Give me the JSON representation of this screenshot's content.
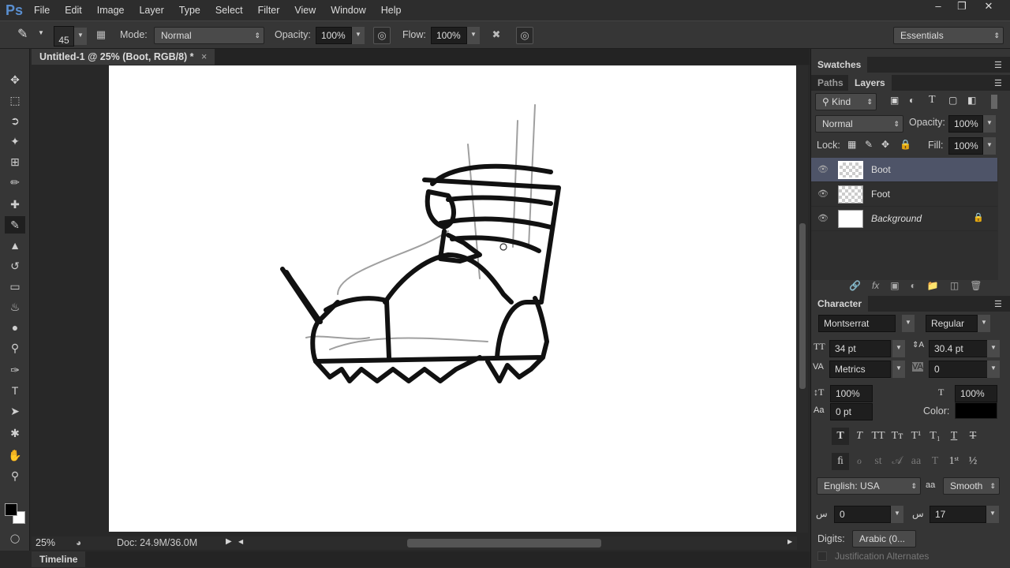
{
  "app": {
    "logo": "Ps",
    "menu": [
      "File",
      "Edit",
      "Image",
      "Layer",
      "Type",
      "Select",
      "Filter",
      "View",
      "Window",
      "Help"
    ],
    "window_controls": [
      "minimize",
      "restore",
      "close"
    ]
  },
  "options": {
    "brush_size": "45",
    "mode_label": "Mode:",
    "mode_value": "Normal",
    "opacity_label": "Opacity:",
    "opacity_value": "100%",
    "flow_label": "Flow:",
    "flow_value": "100%",
    "workspace": "Essentials"
  },
  "document": {
    "tab_title": "Untitled-1 @ 25% (Boot, RGB/8) *",
    "close": "×"
  },
  "status": {
    "zoom": "25%",
    "doc_info": "Doc: 24.9M/36.0M"
  },
  "timeline": {
    "label": "Timeline"
  },
  "swatches": {
    "tab": "Swatches"
  },
  "layers_panel": {
    "tabs": [
      "Paths",
      "Layers"
    ],
    "filter": "Kind",
    "blend_mode": "Normal",
    "opacity_label": "Opacity:",
    "opacity_value": "100%",
    "lock_label": "Lock:",
    "fill_label": "Fill:",
    "fill_value": "100%",
    "layers": [
      {
        "name": "Boot",
        "selected": true
      },
      {
        "name": "Foot"
      },
      {
        "name": "Background",
        "locked": true
      }
    ]
  },
  "character": {
    "tab": "Character",
    "font_family": "Montserrat",
    "font_style": "Regular",
    "size": "34 pt",
    "leading": "30.4 pt",
    "kerning": "Metrics",
    "tracking": "0",
    "vscale": "100%",
    "hscale": "100%",
    "baseline": "0 pt",
    "color_label": "Color:",
    "color": "#000000",
    "language": "English: USA",
    "antialias": "Smooth",
    "kashida_1": "0",
    "kashida_2": "17",
    "digits_label": "Digits:",
    "digits_value": "Arabic (0...",
    "justification": "Justification Alternates"
  }
}
